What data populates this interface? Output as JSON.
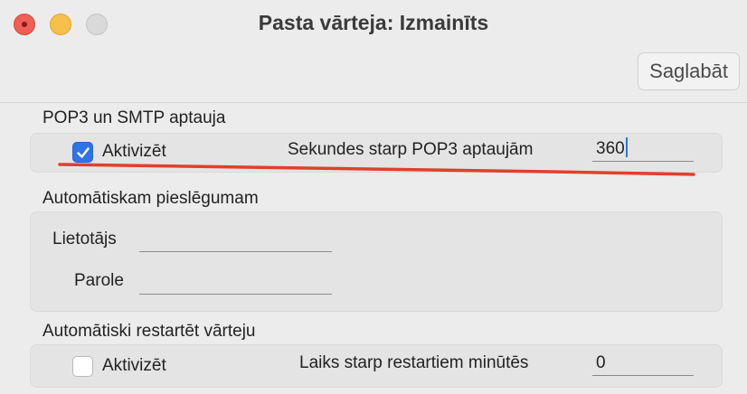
{
  "window": {
    "title": "Pasta vārteja: Izmainīts",
    "save_label": "Saglabāt"
  },
  "pop3_section": {
    "title": "POP3 un SMTP aptauja",
    "enable_label": "Aktivizēt",
    "enable_checked": true,
    "interval_label": "Sekundes starp POP3 aptaujām",
    "interval_value": "360"
  },
  "auth_section": {
    "title": "Automātiskam pieslēgumam",
    "user_label": "Lietotājs",
    "user_value": "",
    "password_label": "Parole",
    "password_value": ""
  },
  "restart_section": {
    "title": "Automātiski restartēt vārteju",
    "enable_label": "Aktivizēt",
    "enable_checked": false,
    "interval_label": "Laiks starp restartiem minūtēs",
    "interval_value": "0"
  },
  "colors": {
    "accent": "#2f73e8",
    "annotation": "#e0402a"
  }
}
